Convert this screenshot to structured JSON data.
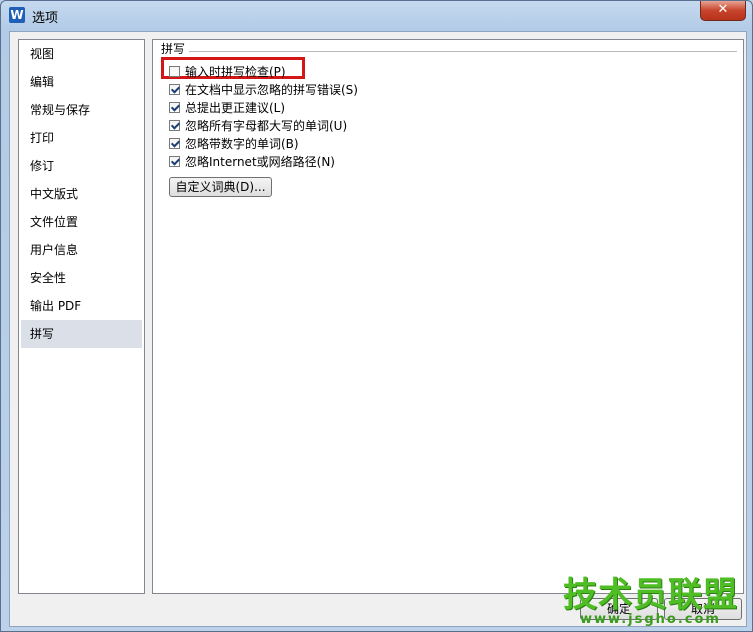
{
  "window": {
    "app_icon": "W",
    "title": "选项",
    "close_label": "✕"
  },
  "nav": {
    "items": [
      {
        "label": "视图"
      },
      {
        "label": "编辑"
      },
      {
        "label": "常规与保存"
      },
      {
        "label": "打印"
      },
      {
        "label": "修订"
      },
      {
        "label": "中文版式"
      },
      {
        "label": "文件位置"
      },
      {
        "label": "用户信息"
      },
      {
        "label": "安全性"
      },
      {
        "label": "输出 PDF"
      },
      {
        "label": "拼写",
        "selected": true
      }
    ]
  },
  "spelling": {
    "group_title": "拼写",
    "options": [
      {
        "label": "输入时拼写检查(P)",
        "checked": false
      },
      {
        "label": "在文档中显示忽略的拼写错误(S)",
        "checked": true
      },
      {
        "label": "总提出更正建议(L)",
        "checked": true
      },
      {
        "label": "忽略所有字母都大写的单词(U)",
        "checked": true
      },
      {
        "label": "忽略带数字的单词(B)",
        "checked": true
      },
      {
        "label": "忽略Internet或网络路径(N)",
        "checked": true
      }
    ],
    "dictionary_button": "自定义词典(D)..."
  },
  "footer": {
    "ok_label": "确定",
    "cancel_label": "取消"
  },
  "watermark": {
    "title": "技术员联盟",
    "url": "www.jsgho.com"
  },
  "colors": {
    "highlight_box": "#d41616",
    "watermark": "#4fbe25"
  }
}
